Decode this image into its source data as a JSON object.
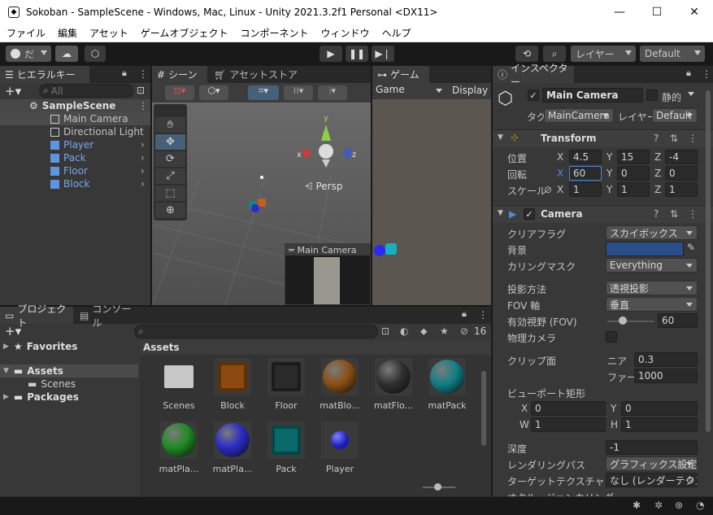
{
  "window": {
    "title": "Sokoban - SampleScene - Windows, Mac, Linux - Unity 2021.3.2f1 Personal <DX11>",
    "minimize": "—",
    "maximize": "☐",
    "close": "✕"
  },
  "menu": [
    "ファイル",
    "編集",
    "アセット",
    "ゲームオブジェクト",
    "コンポーネント",
    "ウィンドウ",
    "ヘルプ"
  ],
  "toolbar": {
    "account_label": "だ",
    "layers_label": "レイヤー",
    "layout_label": "Default"
  },
  "hierarchy": {
    "tab": "ヒエラルキー",
    "search_placeholder": "All",
    "scene": "SampleScene",
    "items": [
      {
        "label": "Main Camera",
        "prefab": false
      },
      {
        "label": "Directional Light",
        "prefab": false
      },
      {
        "label": "Player",
        "prefab": true
      },
      {
        "label": "Pack",
        "prefab": true
      },
      {
        "label": "Floor",
        "prefab": true
      },
      {
        "label": "Block",
        "prefab": true
      }
    ]
  },
  "scene_view": {
    "tab": "シーン",
    "asset_store_tab": "アセットストア",
    "persp_label": "Persp",
    "camera_preview_title": "Main Camera",
    "gizmo_x": "x",
    "gizmo_y": "y",
    "gizmo_z": "z"
  },
  "game_view": {
    "tab": "ゲーム",
    "display_dropdown": "Game",
    "display_label": "Display"
  },
  "inspector": {
    "tab": "インスペクター",
    "object_name": "Main Camera",
    "static_label": "静的",
    "tag_label": "タグ",
    "tag_value": "MainCamera",
    "layer_label": "レイヤー",
    "layer_value": "Default",
    "transform": {
      "title": "Transform",
      "position_label": "位置",
      "rotation_label": "回転",
      "scale_label": "スケール",
      "position": {
        "x": "4.5",
        "y": "15",
        "z": "-4"
      },
      "rotation": {
        "x": "60",
        "y": "0",
        "z": "0"
      },
      "scale": {
        "x": "1",
        "y": "1",
        "z": "1"
      }
    },
    "camera": {
      "title": "Camera",
      "clear_flags_label": "クリアフラグ",
      "clear_flags_value": "スカイボックス",
      "background_label": "背景",
      "background_color": "#2a4e8a",
      "culling_mask_label": "カリングマスク",
      "culling_mask_value": "Everything",
      "projection_label": "投影方法",
      "projection_value": "透視投影",
      "fov_axis_label": "FOV 軸",
      "fov_axis_value": "垂直",
      "fov_label": "有効視野 (FOV)",
      "fov_value": "60",
      "fov_fraction": 0.33,
      "physical_camera_label": "物理カメラ",
      "clipping_label": "クリップ面",
      "near_label": "ニア",
      "near_value": "0.3",
      "far_label": "ファー",
      "far_value": "1000",
      "viewport_label": "ビューポート矩形",
      "vp_x": "0",
      "vp_y": "0",
      "vp_w": "1",
      "vp_h": "1",
      "depth_label": "深度",
      "depth_value": "-1",
      "rendering_path_label": "レンダリングパス",
      "rendering_path_value": "グラフィックス設定を使",
      "target_texture_label": "ターゲットテクスチャ",
      "target_texture_value": "なし (レンダーテクスチ",
      "occlusion_label": "オクルージョンカリング"
    }
  },
  "project": {
    "tab": "プロジェクト",
    "console_tab": "コンソール",
    "hidden_count": "16",
    "favorites": "Favorites",
    "assets_root": "Assets",
    "scenes_folder": "Scenes",
    "packages": "Packages",
    "breadcrumb": "Assets",
    "assets": [
      {
        "label": "Scenes",
        "kind": "folder",
        "color": "#c8c8c8"
      },
      {
        "label": "Block",
        "kind": "prefab",
        "color": "#8a4a12"
      },
      {
        "label": "Floor",
        "kind": "prefab",
        "color": "#2a2a2a"
      },
      {
        "label": "matBlo...",
        "kind": "material",
        "color": "#8a4f14"
      },
      {
        "label": "matFlo...",
        "kind": "material",
        "color": "#2f2f2f"
      },
      {
        "label": "matPack",
        "kind": "material",
        "color": "#0f7f86"
      },
      {
        "label": "matPla...",
        "kind": "material",
        "color": "#1f8a24"
      },
      {
        "label": "matPla...",
        "kind": "material",
        "color": "#2a2ac8"
      },
      {
        "label": "Pack",
        "kind": "prefab",
        "color": "#0a6a6a"
      },
      {
        "label": "Player",
        "kind": "prefab",
        "color": "#1a1ab8"
      }
    ]
  },
  "colors": {
    "accent": "#4a8bd6",
    "prefab_blue": "#7aa7ea",
    "selection": "#2c5d87"
  }
}
